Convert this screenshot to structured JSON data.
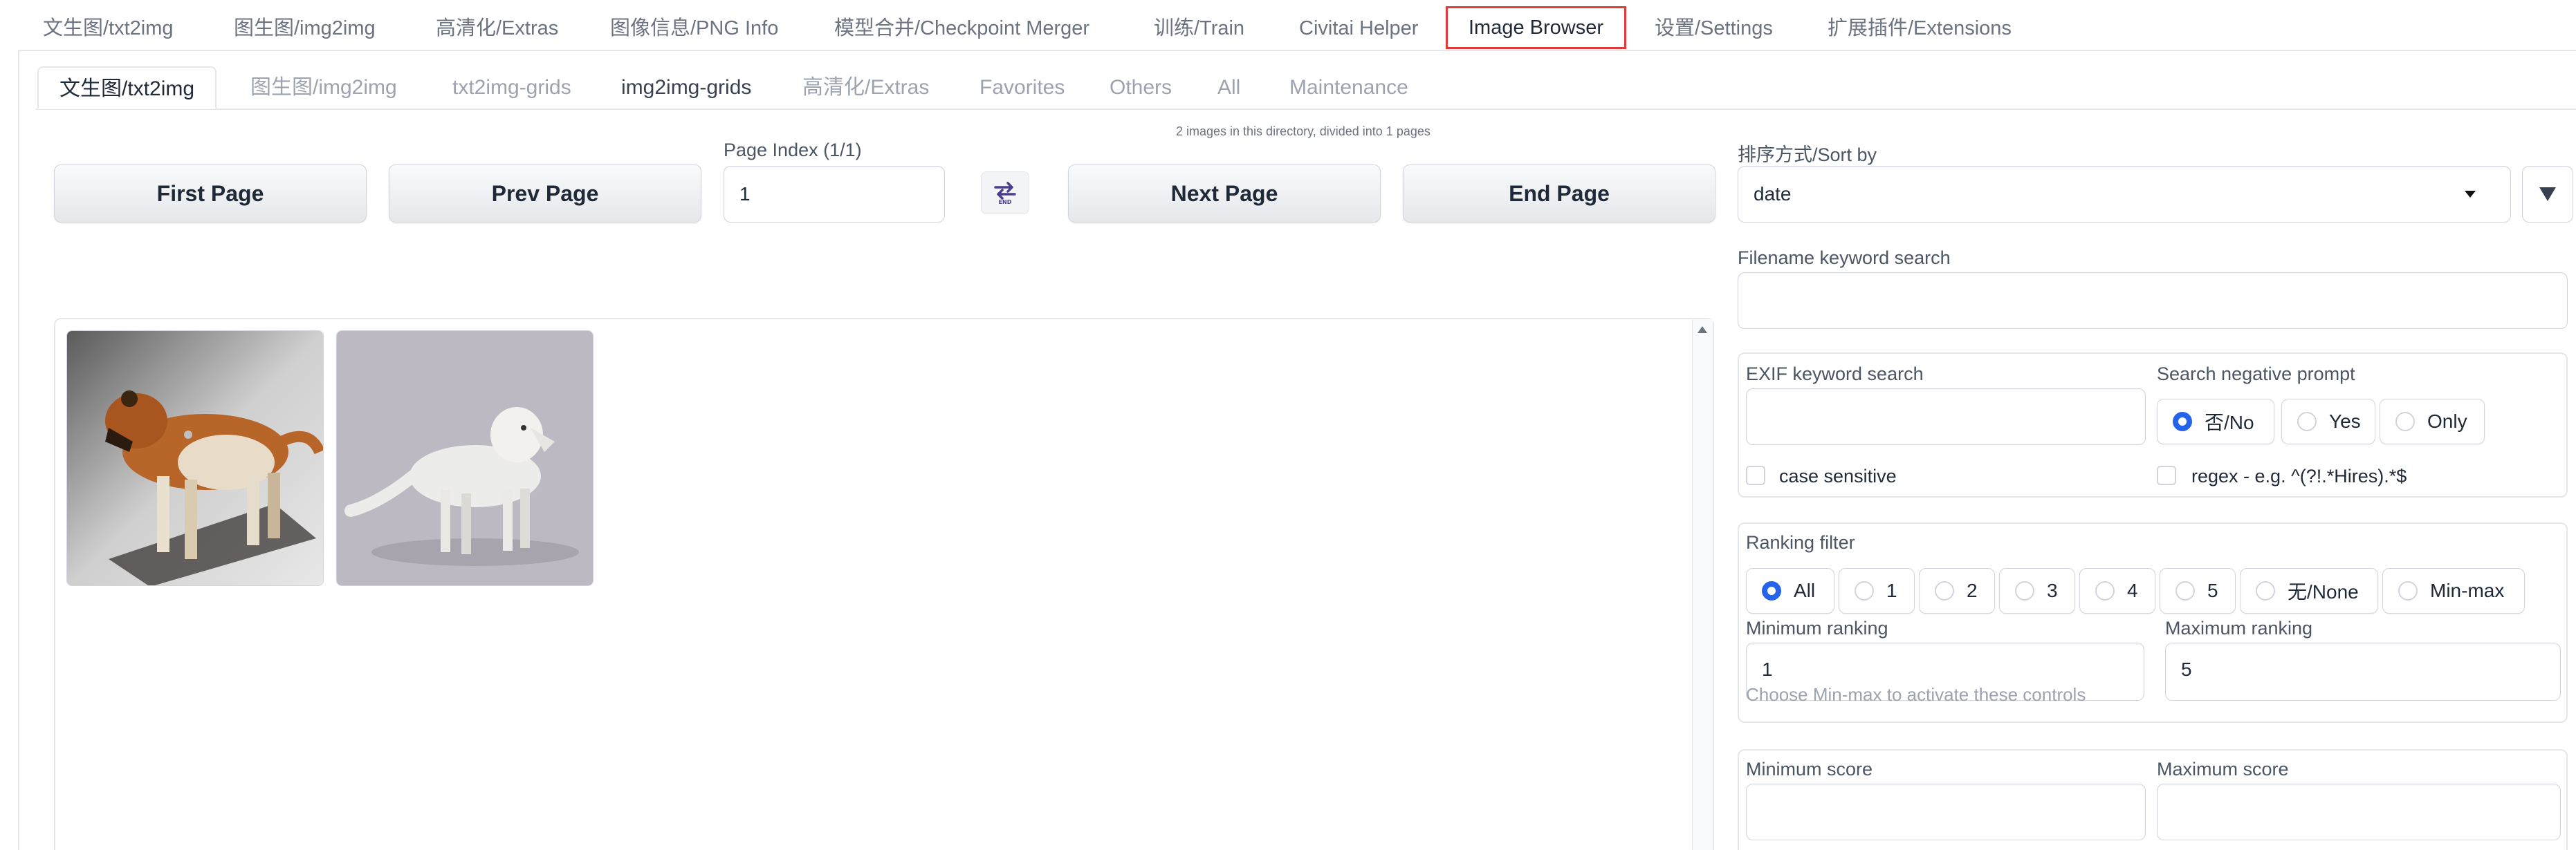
{
  "top_tabs": [
    {
      "label": "文生图/txt2img"
    },
    {
      "label": "图生图/img2img"
    },
    {
      "label": "高清化/Extras"
    },
    {
      "label": "图像信息/PNG Info"
    },
    {
      "label": "模型合并/Checkpoint Merger"
    },
    {
      "label": "训练/Train"
    },
    {
      "label": "Civitai Helper"
    },
    {
      "label": "Image Browser"
    },
    {
      "label": "设置/Settings"
    },
    {
      "label": "扩展插件/Extensions"
    }
  ],
  "top_tab_active": "Image Browser",
  "active_outline_color": "#e03a3a",
  "sub_tabs": [
    {
      "label": "文生图/txt2img"
    },
    {
      "label": "图生图/img2img"
    },
    {
      "label": "txt2img-grids"
    },
    {
      "label": "img2img-grids"
    },
    {
      "label": "高清化/Extras"
    },
    {
      "label": "Favorites"
    },
    {
      "label": "Others"
    },
    {
      "label": "All"
    },
    {
      "label": "Maintenance"
    }
  ],
  "directory_info": "2 images in this directory, divided into 1 pages",
  "pager": {
    "first": "First Page",
    "prev": "Prev Page",
    "next": "Next Page",
    "end": "End Page",
    "page_index_label": "Page Index (1/1)",
    "page_index_value": "1",
    "swap_icon": "swap-end-icon"
  },
  "sort": {
    "label": "排序方式/Sort by",
    "value": "date",
    "order_icon": "sort-direction-icon"
  },
  "filename_search": {
    "label": "Filename keyword search",
    "value": ""
  },
  "exif": {
    "label": "EXIF keyword search",
    "value": "",
    "case_sensitive_label": "case sensitive"
  },
  "negative_prompt": {
    "label": "Search negative prompt",
    "options": [
      "否/No",
      "Yes",
      "Only"
    ],
    "selected": "否/No",
    "regex_label": "regex - e.g. ^(?!.*Hires).*$"
  },
  "ranking": {
    "label": "Ranking filter",
    "options": [
      "All",
      "1",
      "2",
      "3",
      "4",
      "5",
      "无/None",
      "Min-max"
    ],
    "selected": "All",
    "min_label": "Minimum ranking",
    "min_value": "1",
    "max_label": "Maximum ranking",
    "max_value": "5",
    "hint": "Choose Min-max to activate these controls"
  },
  "score": {
    "min_label": "Minimum score",
    "max_label": "Maximum score"
  },
  "accent_color": "#2563eb"
}
